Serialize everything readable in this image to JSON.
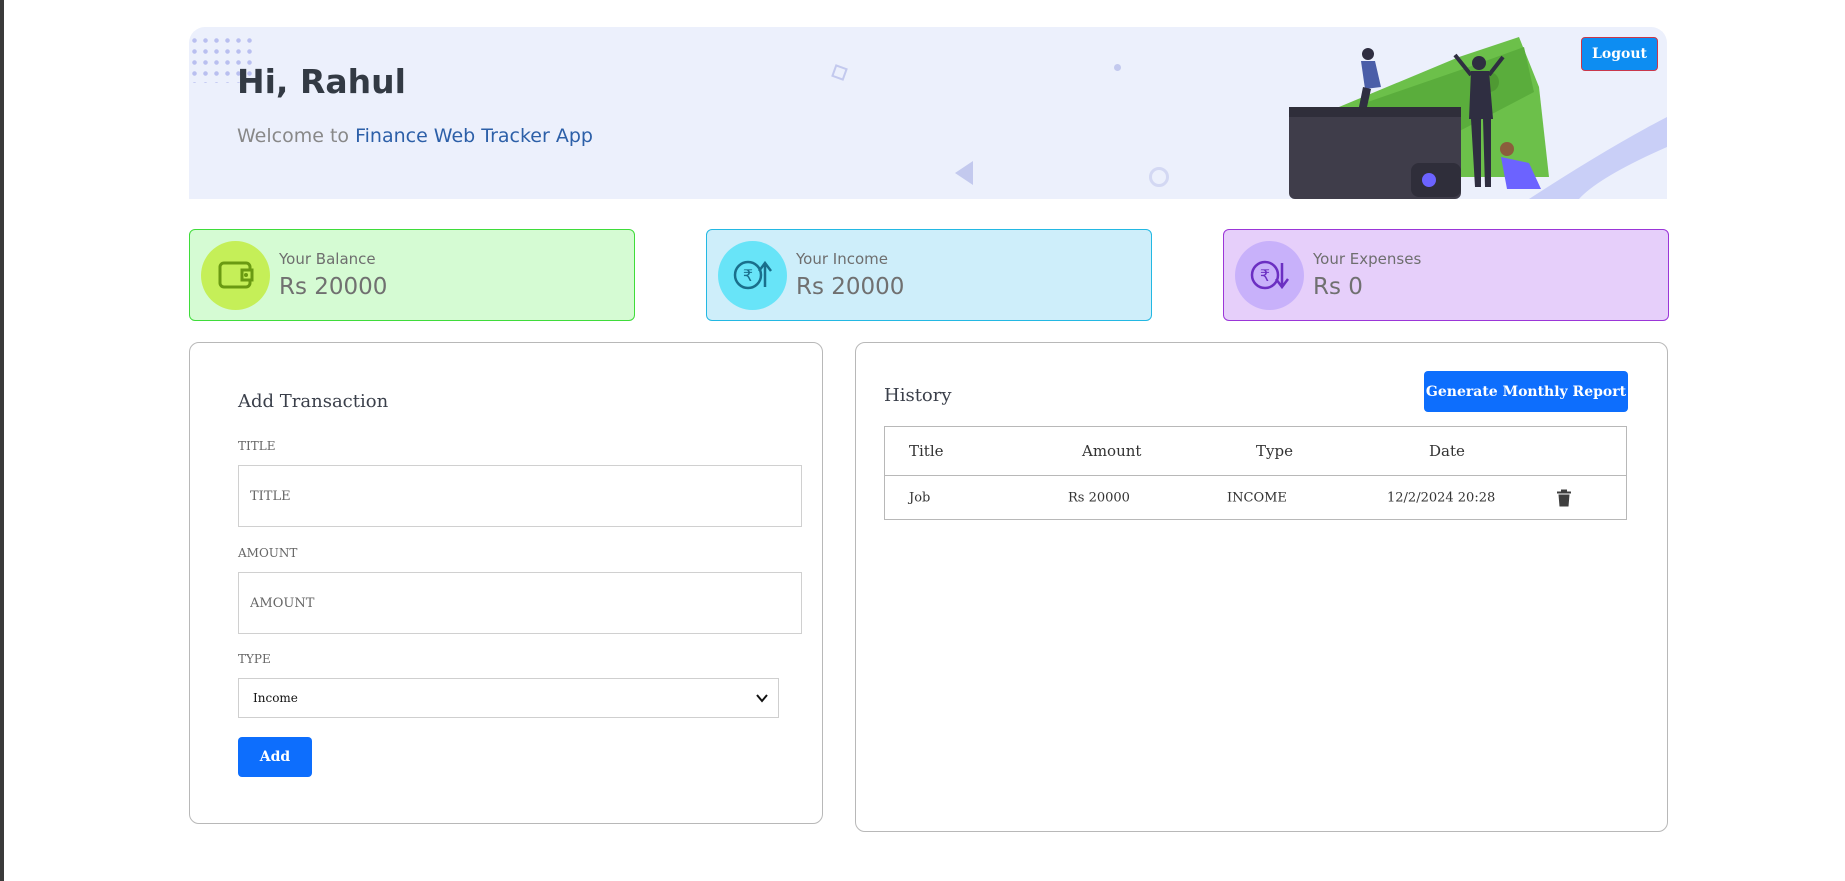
{
  "header": {
    "greeting": "Hi, Rahul",
    "welcome_prefix": "Welcome to ",
    "app_name": "Finance Web Tracker App",
    "logout_label": "Logout"
  },
  "stats": {
    "balance": {
      "label": "Your Balance",
      "value": "Rs 20000",
      "icon": "wallet-icon"
    },
    "income": {
      "label": "Your Income",
      "value": "Rs 20000",
      "icon": "rupee-up-icon"
    },
    "expenses": {
      "label": "Your Expenses",
      "value": "Rs 0",
      "icon": "rupee-down-icon"
    }
  },
  "add_transaction": {
    "title": "Add Transaction",
    "title_field": {
      "label": "TITLE",
      "placeholder": "TITLE"
    },
    "amount_field": {
      "label": "AMOUNT",
      "placeholder": "AMOUNT"
    },
    "type_field": {
      "label": "TYPE",
      "selected": "Income"
    },
    "add_label": "Add"
  },
  "history": {
    "title": "History",
    "report_label": "Generate Monthly Report",
    "columns": [
      "Title",
      "Amount",
      "Type",
      "Date"
    ],
    "rows": [
      {
        "title": "Job",
        "amount": "Rs 20000",
        "type": "INCOME",
        "date": "12/2/2024 20:28"
      }
    ]
  },
  "colors": {
    "primary": "#0d6efd",
    "logout": "#0d8df2",
    "balance_bg": "#d5fbd3",
    "income_bg": "#ceeefa",
    "expense_bg": "#e6cffa"
  }
}
